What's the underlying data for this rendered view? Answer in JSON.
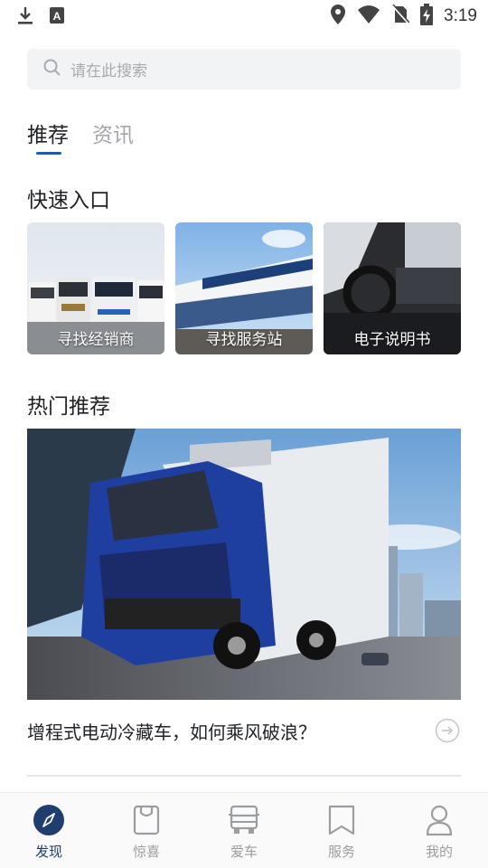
{
  "status_bar": {
    "time": "3:19"
  },
  "search": {
    "placeholder": "请在此搜索"
  },
  "tabs": [
    {
      "label": "推荐",
      "active": true
    },
    {
      "label": "资讯",
      "active": false
    }
  ],
  "quick_entry": {
    "title": "快速入口",
    "items": [
      {
        "label": "寻找经销商"
      },
      {
        "label": "寻找服务站"
      },
      {
        "label": "电子说明书"
      }
    ]
  },
  "hot": {
    "title": "热门推荐",
    "article_title": "增程式电动冷藏车，如何乘风破浪？"
  },
  "bottom_nav": [
    {
      "label": "发现",
      "icon": "compass-icon",
      "active": true
    },
    {
      "label": "惊喜",
      "icon": "shopping-bag-icon",
      "active": false
    },
    {
      "label": "爱车",
      "icon": "truck-icon",
      "active": false
    },
    {
      "label": "服务",
      "icon": "bookmark-icon",
      "active": false
    },
    {
      "label": "我的",
      "icon": "user-icon",
      "active": false
    }
  ],
  "colors": {
    "accent": "#1f3e6e",
    "tab_underline": "#1f5ca8",
    "search_bg": "#f2f3f5"
  }
}
